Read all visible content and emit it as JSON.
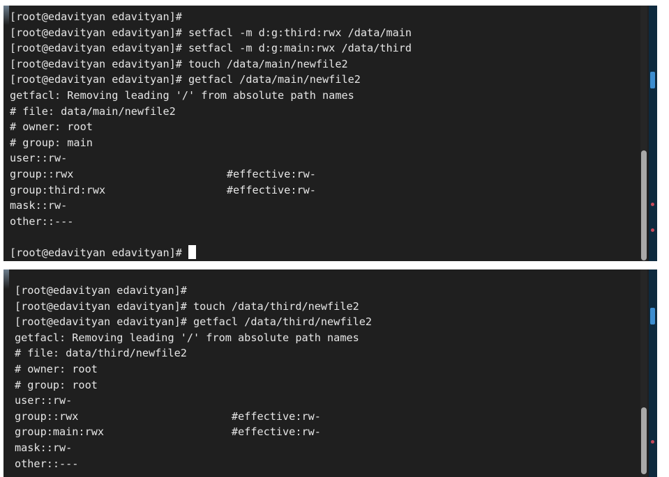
{
  "top_terminal": {
    "lines": [
      "[root@edavityan edavityan]#",
      "[root@edavityan edavityan]# setfacl -m d:g:third:rwx /data/main",
      "[root@edavityan edavityan]# setfacl -m d:g:main:rwx /data/third",
      "[root@edavityan edavityan]# touch /data/main/newfile2",
      "[root@edavityan edavityan]# getfacl /data/main/newfile2",
      "getfacl: Removing leading '/' from absolute path names",
      "# file: data/main/newfile2",
      "# owner: root",
      "# group: main",
      "user::rw-",
      "group::rwx                        #effective:rw-",
      "group:third:rwx                   #effective:rw-",
      "mask::rw-",
      "other::---",
      ""
    ],
    "prompt": "[root@edavityan edavityan]# "
  },
  "bottom_terminal": {
    "lines": [
      "[root@edavityan edavityan]#",
      "[root@edavityan edavityan]# touch /data/third/newfile2",
      "[root@edavityan edavityan]# getfacl /data/third/newfile2",
      "getfacl: Removing leading '/' from absolute path names",
      "# file: data/third/newfile2",
      "# owner: root",
      "# group: root",
      "user::rw-",
      "group::rwx                        #effective:rw-",
      "group:main:rwx                    #effective:rw-",
      "mask::rw-",
      "other::---"
    ]
  },
  "colors": {
    "terminal_background": "#1f1f1f",
    "terminal_text": "#e6e6e6",
    "scrollbar_thumb": "#a9a9a9",
    "desktop_accent": "#3d8ed0"
  }
}
